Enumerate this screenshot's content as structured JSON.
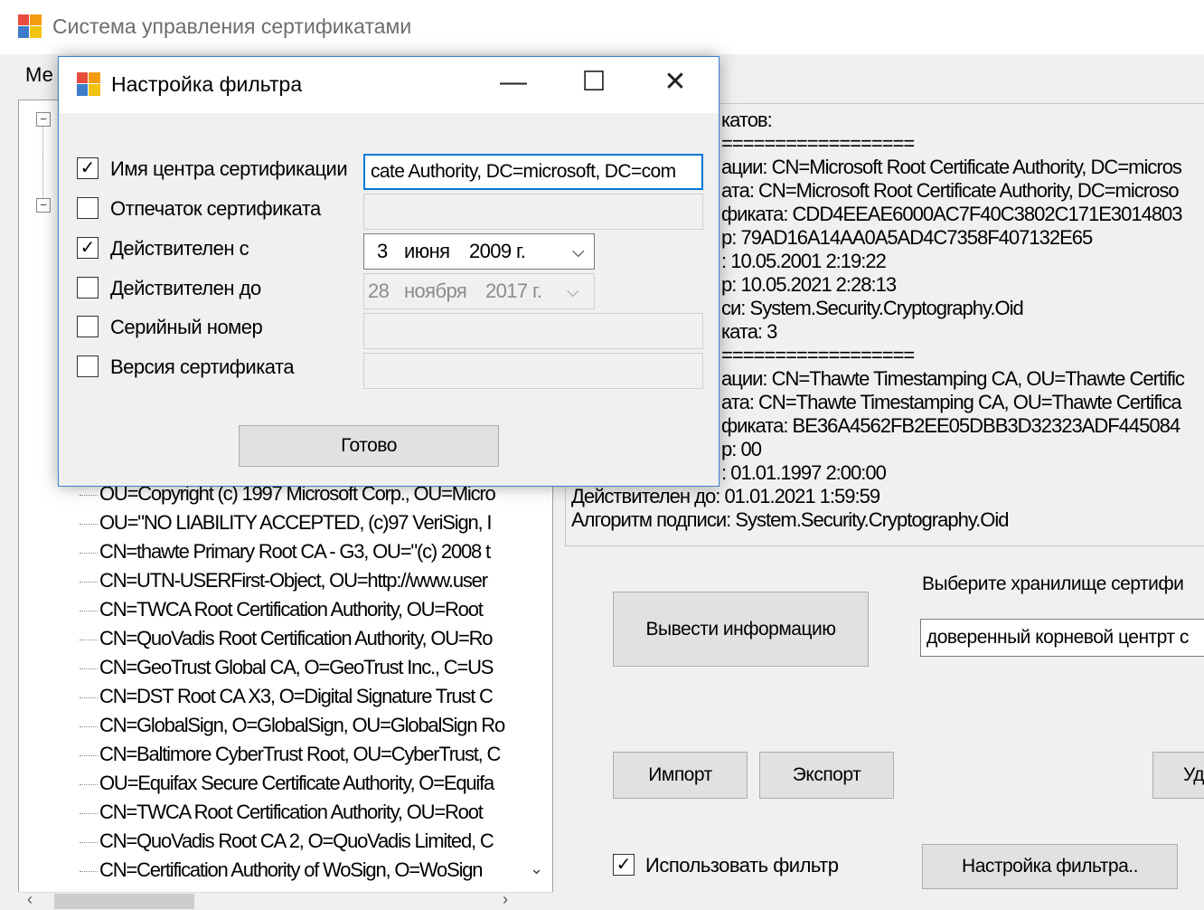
{
  "window": {
    "title": "Система управления сертификатами"
  },
  "menu": {
    "first_item": "Ме"
  },
  "tree": {
    "items": [
      "OU=Copyright (c) 1997 Microsoft Corp., OU=Micro",
      "OU=\"NO LIABILITY ACCEPTED, (c)97 VeriSign, I",
      "CN=thawte Primary Root CA - G3, OU=\"(c) 2008 t",
      "CN=UTN-USERFirst-Object, OU=http://www.user",
      "CN=TWCA Root Certification Authority, OU=Root",
      "CN=QuoVadis Root Certification Authority, OU=Ro",
      "CN=GeoTrust Global CA, O=GeoTrust Inc., C=US",
      "CN=DST Root CA X3, O=Digital Signature Trust C",
      "CN=GlobalSign, O=GlobalSign, OU=GlobalSign Ro",
      "CN=Baltimore CyberTrust Root, OU=CyberTrust, C",
      "OU=Equifax Secure Certificate Authority, O=Equifa",
      "CN=TWCA Root Certification Authority, OU=Root",
      "CN=QuoVadis Root CA 2, O=QuoVadis Limited, C",
      "CN=Certification Authority of WoSign, O=WoSign"
    ]
  },
  "info": {
    "lines": [
      "катов:",
      "==================",
      "ации: CN=Microsoft Root Certificate Authority, DC=micros",
      "ата: CN=Microsoft Root Certificate Authority, DC=microso",
      "фиката: CDD4EEAE6000AC7F40C3802C171E3014803",
      "р: 79AD16A14AA0A5AD4C7358F407132E65",
      ": 10.05.2001 2:19:22",
      "р: 10.05.2021 2:28:13",
      "си: System.Security.Cryptography.Oid",
      "ката: 3",
      "==================",
      "ации: CN=Thawte Timestamping CA, OU=Thawte Certific",
      "ата: CN=Thawte Timestamping CA, OU=Thawte Certifica",
      "фиката: BE36A4562FB2EE05DBB3D32323ADF445084",
      "р: 00",
      ": 01.01.1997 2:00:00",
      "Действителен до: 01.01.2021 1:59:59",
      "Алгоритм подписи: System.Security.Cryptography.Oid"
    ]
  },
  "controls": {
    "show_info": "Вывести информацию",
    "store_label": "Выберите хранилище сертифи",
    "store_value": "доверенный корневой центрт с",
    "import": "Импорт",
    "export": "Экспорт",
    "delete": "Уд",
    "use_filter": "Использовать фильтр",
    "filter_settings": "Настройка фильтра.."
  },
  "dialog": {
    "title": "Настройка фильтра",
    "minimize_glyph": "—",
    "maximize_glyph": "☐",
    "close_glyph": "✕",
    "fields": [
      {
        "label": "Имя центра сертификации",
        "checked": true,
        "value": "cate Authority, DC=microsoft, DC=com"
      },
      {
        "label": "Отпечаток сертификата",
        "checked": false,
        "value": ""
      },
      {
        "label": "Действителен с",
        "checked": true,
        "day": "3",
        "month": "июня",
        "year": "2009 г."
      },
      {
        "label": "Действителен до",
        "checked": false,
        "day": "28",
        "month": "ноября",
        "year": "2017 г."
      },
      {
        "label": "Серийный номер",
        "checked": false,
        "value": ""
      },
      {
        "label": "Версия сертификата",
        "checked": false,
        "value": ""
      }
    ],
    "done": "Готово"
  },
  "colors": {
    "accent": "#0078d7",
    "dialog_border": "#3c7fd0"
  }
}
